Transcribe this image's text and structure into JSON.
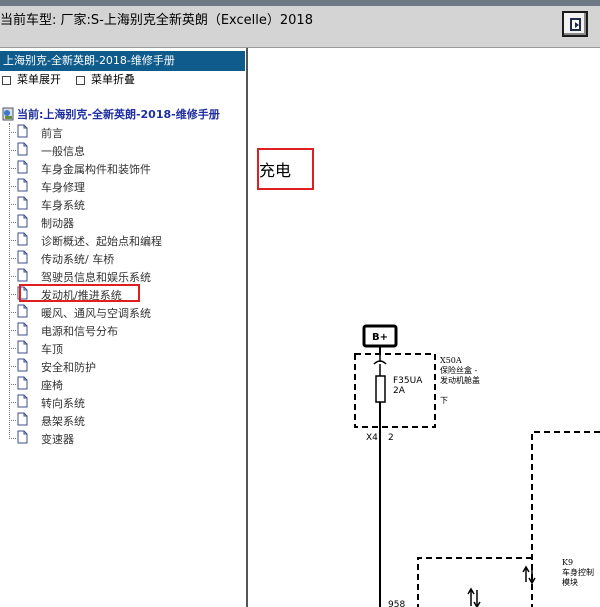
{
  "window": {
    "title": "当前车型:  厂家:S-上海别克全新英朗（Excelle）2018",
    "toolbar_icon": "exit-icon"
  },
  "sidebar": {
    "header": "上海别克-全新英朗-2018-维修手册",
    "expand_label": "菜单展开",
    "collapse_label": "菜单折叠",
    "root_label": "当前:上海别克-全新英朗-2018-维修手册",
    "items": [
      {
        "label": "前言"
      },
      {
        "label": "一般信息"
      },
      {
        "label": "车身金属构件和装饰件"
      },
      {
        "label": "车身修理"
      },
      {
        "label": "车身系统"
      },
      {
        "label": "制动器"
      },
      {
        "label": "诊断概述、起始点和编程"
      },
      {
        "label": "传动系统/ 车桥"
      },
      {
        "label": "驾驶员信息和娱乐系统"
      },
      {
        "label": "发动机/推进系统",
        "selected": true
      },
      {
        "label": "暖风、通风与空调系统"
      },
      {
        "label": "电源和信号分布"
      },
      {
        "label": "车顶"
      },
      {
        "label": "安全和防护"
      },
      {
        "label": "座椅"
      },
      {
        "label": "转向系统"
      },
      {
        "label": "悬架系统"
      },
      {
        "label": "变速器"
      }
    ]
  },
  "content": {
    "section_title": "充电",
    "diagram": {
      "battery_label": "B+",
      "fuse_block_id": "X50A",
      "fuse_block_name_line1": "保险丝盒 -",
      "fuse_block_name_line2": "发动机舱盖",
      "fuse_block_name_line3": "下",
      "fuse_id": "F35UA",
      "fuse_rating": "2A",
      "connector": "X4",
      "pin": "2",
      "wire_partial": "958",
      "module_id": "K9",
      "module_name_line1": "车身控制",
      "module_name_line2": "模块"
    }
  },
  "colors": {
    "sidebar_header": "#0e5b8c",
    "highlight": "#e02020",
    "root_text": "#1f2f9f"
  }
}
